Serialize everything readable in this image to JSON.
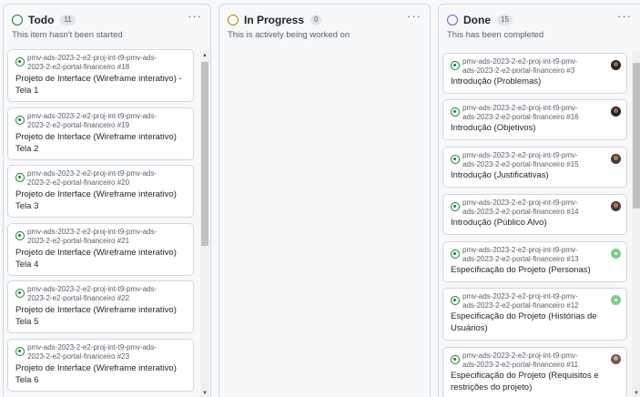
{
  "columns": [
    {
      "name": "Todo",
      "count": "11",
      "description": "This item hasn't been started",
      "status_color": "#1a7f37",
      "cards": [
        {
          "ref_line1": "pmv-ads-2023-2-e2-proj-int-t9-pmv-ads-",
          "ref_line2": "2023-2-e2-portal-financeiro #18",
          "title_line1": "Projeto de Interface (Wireframe interativo) -",
          "title_line2": "Tela 1"
        },
        {
          "ref_line1": "pmv-ads-2023-2-e2-proj-int-t9-pmv-ads-",
          "ref_line2": "2023-2-e2-portal-financeiro #19",
          "title_line1": "Projeto de Interface (Wireframe interativo)",
          "title_line2": "Tela 2"
        },
        {
          "ref_line1": "pmv-ads-2023-2-e2-proj-int-t9-pmv-ads-",
          "ref_line2": "2023-2-e2-portal-financeiro #20",
          "title_line1": "Projeto de Interface (Wireframe interativo)",
          "title_line2": "Tela 3"
        },
        {
          "ref_line1": "pmv-ads-2023-2-e2-proj-int-t9-pmv-ads-",
          "ref_line2": "2023-2-e2-portal-financeiro #21",
          "title_line1": "Projeto de Interface (Wireframe interativo)",
          "title_line2": "Tela 4"
        },
        {
          "ref_line1": "pmv-ads-2023-2-e2-proj-int-t9-pmv-ads-",
          "ref_line2": "2023-2-e2-portal-financeiro #22",
          "title_line1": "Projeto de Interface (Wireframe interativo)",
          "title_line2": "Tela 5"
        },
        {
          "ref_line1": "pmv-ads-2023-2-e2-proj-int-t9-pmv-ads-",
          "ref_line2": "2023-2-e2-portal-financeiro #23",
          "title_line1": "Projeto de Interface (Wireframe interativo)",
          "title_line2": "Tela 6"
        }
      ]
    },
    {
      "name": "In Progress",
      "count": "0",
      "description": "This is actively being worked on",
      "status_color": "#bf8700",
      "cards": []
    },
    {
      "name": "Done",
      "count": "15",
      "description": "This has been completed",
      "status_color": "#8250df",
      "cards": [
        {
          "ref_line1": "pmv-ads-2023-2-e2-proj-int-t9-pmv-",
          "ref_line2": "ads-2023-2-e2-portal-financeiro #3",
          "title_line1": "Introdução (Problemas)",
          "title_line2": "",
          "avatar": "avatar-dark"
        },
        {
          "ref_line1": "pmv-ads-2023-2-e2-proj-int-t9-pmv-",
          "ref_line2": "ads-2023-2-e2-portal-financeiro #16",
          "title_line1": "Introdução (Objetivos)",
          "title_line2": "",
          "avatar": "avatar-dark"
        },
        {
          "ref_line1": "pmv-ads-2023-2-e2-proj-int-t9-pmv-",
          "ref_line2": "ads-2023-2-e2-portal-financeiro #15",
          "title_line1": "Introdução (Justificativas)",
          "title_line2": "",
          "avatar": "avatar-brown"
        },
        {
          "ref_line1": "pmv-ads-2023-2-e2-proj-int-t9-pmv-",
          "ref_line2": "ads-2023-2-e2-portal-financeiro #14",
          "title_line1": "Introdução (Público Alvo)",
          "title_line2": "",
          "avatar": "avatar-brown"
        },
        {
          "ref_line1": "pmv-ads-2023-2-e2-proj-int-t9-pmv-",
          "ref_line2": "ads-2023-2-e2-portal-financeiro #13",
          "title_line1": "Especificação do Projeto (Personas)",
          "title_line2": "",
          "avatar": "avatar-green"
        },
        {
          "ref_line1": "pmv-ads-2023-2-e2-proj-int-t9-pmv-",
          "ref_line2": "ads-2023-2-e2-portal-financeiro #12",
          "title_line1": "Especificação do Projeto (Histórias de",
          "title_line2": "Usuários)",
          "avatar": "avatar-green"
        },
        {
          "ref_line1": "pmv-ads-2023-2-e2-proj-int-t9-pmv-",
          "ref_line2": "ads-2023-2-e2-portal-financeiro #11",
          "title_line1": "Especificação do Projeto (Requisitos e",
          "title_line2": "restrições do projeto)",
          "avatar": "avatar-photo"
        }
      ]
    }
  ]
}
